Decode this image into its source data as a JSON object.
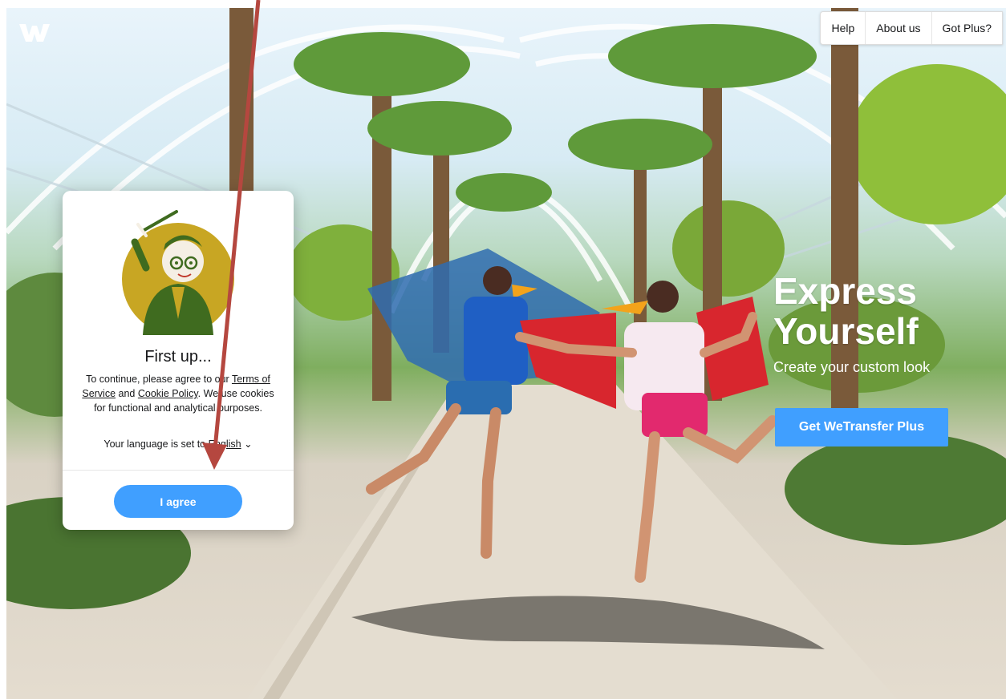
{
  "brand": {
    "logo_icon": "wetransfer-logo-icon",
    "accent": "#409fff"
  },
  "nav": {
    "items": [
      "Help",
      "About us",
      "Got Plus?"
    ]
  },
  "hero": {
    "title_line1": "Express",
    "title_line2": "Yourself",
    "subtitle": "Create your custom look",
    "cta": "Get WeTransfer Plus"
  },
  "consent": {
    "title": "First up...",
    "body_pre": "To continue, please agree to our ",
    "terms": "Terms of Service",
    "and": " and ",
    "cookie": "Cookie Policy",
    "body_post": ". We use cookies for functional and analytical purposes.",
    "lang_prefix": "Your language is set to ",
    "lang_value": "English",
    "agree": "I agree"
  },
  "annotation": {
    "arrow_color": "#b5473f",
    "arrow_icon": "red-arrow-pointer"
  }
}
